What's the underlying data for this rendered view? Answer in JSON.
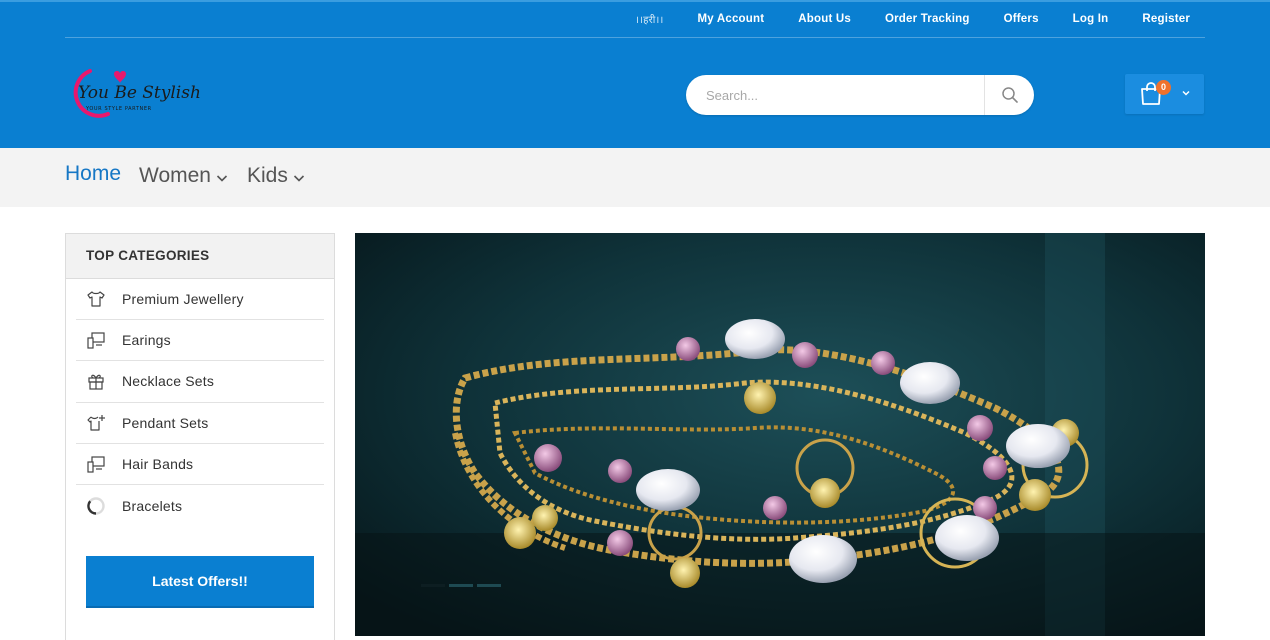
{
  "topbar": {
    "language": "।।हरी।।",
    "links": [
      "My Account",
      "About Us",
      "Order Tracking",
      "Offers",
      "Log In",
      "Register"
    ]
  },
  "logo": {
    "text": "You Be Stylish",
    "tagline": "YOUR STYLE PARTNER"
  },
  "search": {
    "placeholder": "Search...",
    "icon": "search-icon"
  },
  "cart": {
    "count": "0",
    "icon": "shopping-bag-icon"
  },
  "nav": {
    "items": [
      {
        "label": "Home",
        "active": true
      },
      {
        "label": "Women",
        "dropdown": true
      },
      {
        "label": "Kids",
        "dropdown": true
      }
    ]
  },
  "sidebar": {
    "title": "TOP CATEGORIES",
    "categories": [
      {
        "label": "Premium Jewellery",
        "icon": "tshirt-icon"
      },
      {
        "label": "Earings",
        "icon": "devices-icon"
      },
      {
        "label": "Necklace Sets",
        "icon": "gift-icon"
      },
      {
        "label": "Pendant Sets",
        "icon": "shirt-plus-icon"
      },
      {
        "label": "Hair Bands",
        "icon": "devices-icon"
      },
      {
        "label": "Bracelets",
        "icon": "loading-ring-icon"
      }
    ],
    "offers_button": "Latest Offers!!"
  },
  "colors": {
    "brand_blue": "#0a7fd1",
    "cart_badge": "#f0712b",
    "logo_pink": "#e8186d",
    "nav_active": "#1677c5"
  }
}
